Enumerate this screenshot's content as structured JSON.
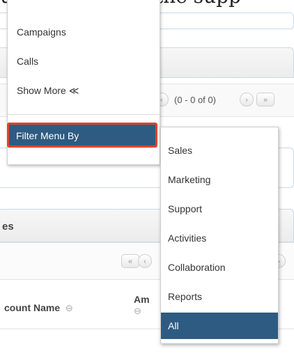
{
  "top_caption": "use only one of the supp",
  "left_menu": {
    "items": [
      "Campaigns",
      "Calls",
      "Show More ≪"
    ],
    "filter_label": "Filter Menu By"
  },
  "submenu": {
    "items": [
      "Sales",
      "Marketing",
      "Support",
      "Activities",
      "Collaboration",
      "Reports",
      "All"
    ],
    "active": "All"
  },
  "background": {
    "pager_text": "(0 - 0 of 0)",
    "panel_title_fragment": "es",
    "columns": [
      "count Name",
      "Am"
    ],
    "sort_glyph": "⊖"
  },
  "colors": {
    "highlight": "#2e5b82",
    "focus_border": "#e0452a"
  }
}
